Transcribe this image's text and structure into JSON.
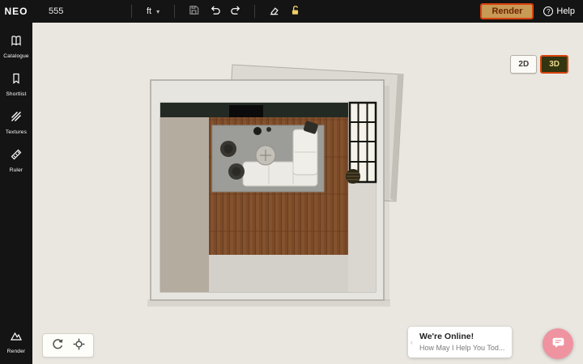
{
  "topbar": {
    "logo": "NEO",
    "project_number": "555",
    "unit": "ft",
    "chevron": "▾",
    "render_label": "Render",
    "help_glyph": "?",
    "help_label": "Help",
    "icons": [
      "save-icon",
      "undo-icon",
      "redo-icon",
      "eraser-icon",
      "unlock-icon"
    ]
  },
  "sidebar": {
    "items": [
      {
        "label": "Catalogue",
        "icon": "catalogue-icon"
      },
      {
        "label": "Shortlist",
        "icon": "shortlist-icon"
      },
      {
        "label": "Textures",
        "icon": "textures-icon"
      },
      {
        "label": "Ruler",
        "icon": "ruler-icon"
      }
    ],
    "bottom_item": {
      "label": "Render",
      "icon": "render-icon"
    }
  },
  "view_toggle": {
    "d2_label": "2D",
    "d3_label": "3D",
    "active": "3D"
  },
  "canvas": {
    "scene": "Top-down 3D view of a square room: dark wood plank floor, gray rug with white sectional sofa, two dark armchairs, round coffee table, black-framed window wall on the right, dark accent far wall with fireplace, detached wall panel behind upper-right"
  },
  "mini_toolbar": {
    "icons": [
      "reset-view-icon",
      "focus-icon"
    ]
  },
  "chat": {
    "collapse_glyph": "‹",
    "title": "We're Online!",
    "subtitle": "How May I Help You Tod...",
    "icon": "chat-bubble-icon"
  },
  "colors": {
    "topbar_bg": "#141414",
    "canvas_bg": "#eae7e0",
    "highlight_border": "#d8430f",
    "render_button_bg": "#c79a55",
    "active_3d_bg": "#32350f",
    "chat_accent": "#ef93a0",
    "wood_floor": "#7a4a28",
    "dark_wall": "#232a24"
  }
}
